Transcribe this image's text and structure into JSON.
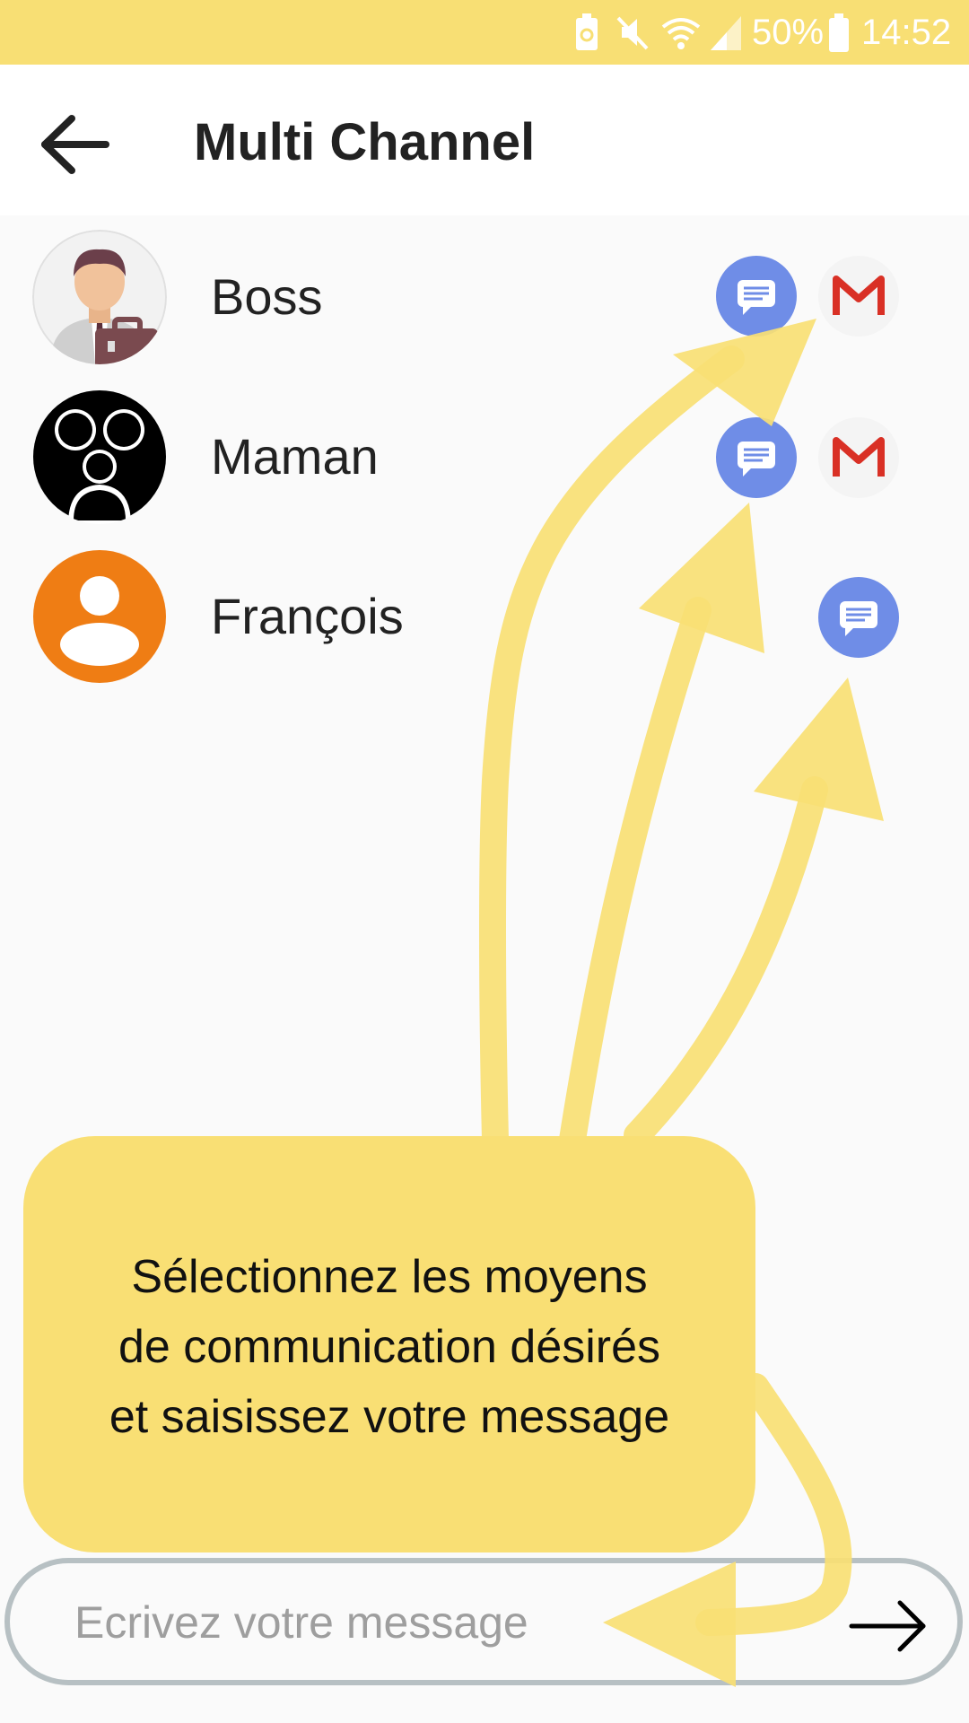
{
  "status_bar": {
    "battery_percent": "50%",
    "time": "14:52",
    "icons": [
      "battery-saver-icon",
      "mute-icon",
      "wifi-icon",
      "signal-icon",
      "battery-icon"
    ]
  },
  "app_bar": {
    "title": "Multi Channel",
    "back_icon": "arrow-left-icon"
  },
  "contacts": [
    {
      "name": "Boss",
      "avatar": "businessman-avatar",
      "channels": [
        "sms",
        "gmail"
      ]
    },
    {
      "name": "Maman",
      "avatar": "group-avatar",
      "channels": [
        "sms",
        "gmail"
      ]
    },
    {
      "name": "François",
      "avatar": "default-person-avatar",
      "channels": [
        "sms"
      ]
    }
  ],
  "composer": {
    "placeholder": "Ecrivez votre message",
    "value": "",
    "send_icon": "arrow-right-icon"
  },
  "tutorial_overlay": {
    "line1": "Sélectionnez les moyens",
    "line2": "de communication désirés",
    "line3": "et saisissez votre message",
    "color": "#f9df74"
  },
  "colors": {
    "status_bar": "#f8df74",
    "sms": "#6f8de7",
    "gmail_red": "#d93025",
    "francois_avatar": "#ef7d14"
  }
}
